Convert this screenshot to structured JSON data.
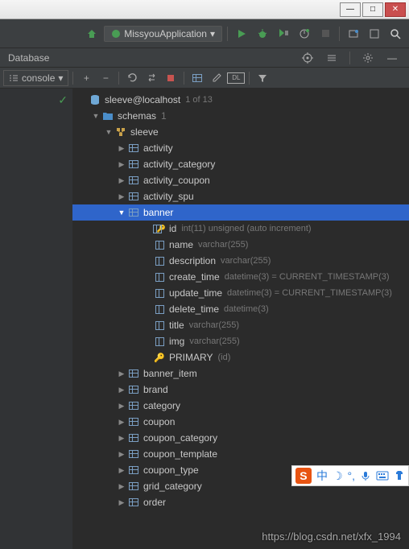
{
  "titlebar": {
    "min": "—",
    "max": "□",
    "close": "✕"
  },
  "toolbar": {
    "run_config": "MissyouApplication",
    "chevron": "▾"
  },
  "panel": {
    "title": "Database"
  },
  "tabs": {
    "console": "console",
    "chevron": "▾"
  },
  "tree": {
    "connection": "sleeve@localhost",
    "conn_count": "1 of 13",
    "schemas_label": "schemas",
    "schemas_count": "1",
    "db": "sleeve",
    "tables": [
      "activity",
      "activity_category",
      "activity_coupon",
      "activity_spu",
      "banner",
      "banner_item",
      "brand",
      "category",
      "coupon",
      "coupon_category",
      "coupon_template",
      "coupon_type",
      "grid_category",
      "order"
    ],
    "banner_cols": [
      {
        "name": "id",
        "type": "int(11) unsigned (auto increment)",
        "pk": true
      },
      {
        "name": "name",
        "type": "varchar(255)",
        "pk": false
      },
      {
        "name": "description",
        "type": "varchar(255)",
        "pk": false
      },
      {
        "name": "create_time",
        "type": "datetime(3) = CURRENT_TIMESTAMP(3)",
        "pk": false
      },
      {
        "name": "update_time",
        "type": "datetime(3) = CURRENT_TIMESTAMP(3)",
        "pk": false
      },
      {
        "name": "delete_time",
        "type": "datetime(3)",
        "pk": false
      },
      {
        "name": "title",
        "type": "varchar(255)",
        "pk": false
      },
      {
        "name": "img",
        "type": "varchar(255)",
        "pk": false
      }
    ],
    "primary_label": "PRIMARY",
    "primary_cols": "(id)"
  },
  "ime": {
    "s": "S",
    "zhong": "中"
  },
  "watermark": "https://blog.csdn.net/xfx_1994"
}
